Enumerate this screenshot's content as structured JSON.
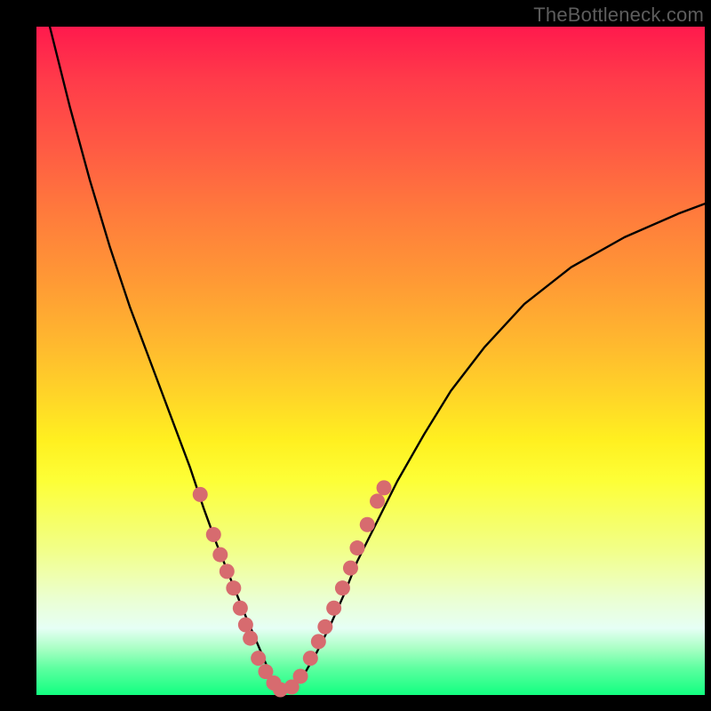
{
  "watermark": "TheBottleneck.com",
  "chart_data": {
    "type": "line",
    "title": "",
    "xlabel": "",
    "ylabel": "",
    "xlim": [
      0,
      100
    ],
    "ylim": [
      0,
      100
    ],
    "series": [
      {
        "name": "curve",
        "x": [
          2,
          5,
          8,
          11,
          14,
          17,
          20,
          23,
          25,
          27,
          29,
          31,
          32.5,
          34,
          35,
          36,
          37,
          38.5,
          40,
          42,
          44,
          46,
          48,
          51,
          54,
          58,
          62,
          67,
          73,
          80,
          88,
          96,
          100
        ],
        "y": [
          100,
          88,
          77,
          67,
          58,
          50,
          42,
          34,
          28,
          22.5,
          17.5,
          12.5,
          9,
          5.5,
          3,
          1.2,
          0.5,
          1.2,
          3,
          6.5,
          10.5,
          15,
          20,
          26,
          32,
          39,
          45.5,
          52,
          58.5,
          64,
          68.5,
          72,
          73.5
        ]
      }
    ],
    "markers": {
      "name": "dots",
      "points": [
        [
          24.5,
          30
        ],
        [
          26.5,
          24
        ],
        [
          27.5,
          21
        ],
        [
          28.5,
          18.5
        ],
        [
          29.5,
          16
        ],
        [
          30.5,
          13
        ],
        [
          31.3,
          10.5
        ],
        [
          32,
          8.5
        ],
        [
          33.2,
          5.5
        ],
        [
          34.3,
          3.5
        ],
        [
          35.5,
          1.8
        ],
        [
          36.5,
          0.8
        ],
        [
          38.2,
          1.2
        ],
        [
          39.5,
          2.8
        ],
        [
          41,
          5.5
        ],
        [
          42.2,
          8
        ],
        [
          43.2,
          10.2
        ],
        [
          44.5,
          13
        ],
        [
          45.8,
          16
        ],
        [
          47,
          19
        ],
        [
          48,
          22
        ],
        [
          49.5,
          25.5
        ],
        [
          51,
          29
        ],
        [
          52,
          31
        ]
      ]
    },
    "colors": {
      "curve": "#000000",
      "marker_fill": "#d76b6f",
      "marker_stroke": "#d76b6f"
    }
  }
}
